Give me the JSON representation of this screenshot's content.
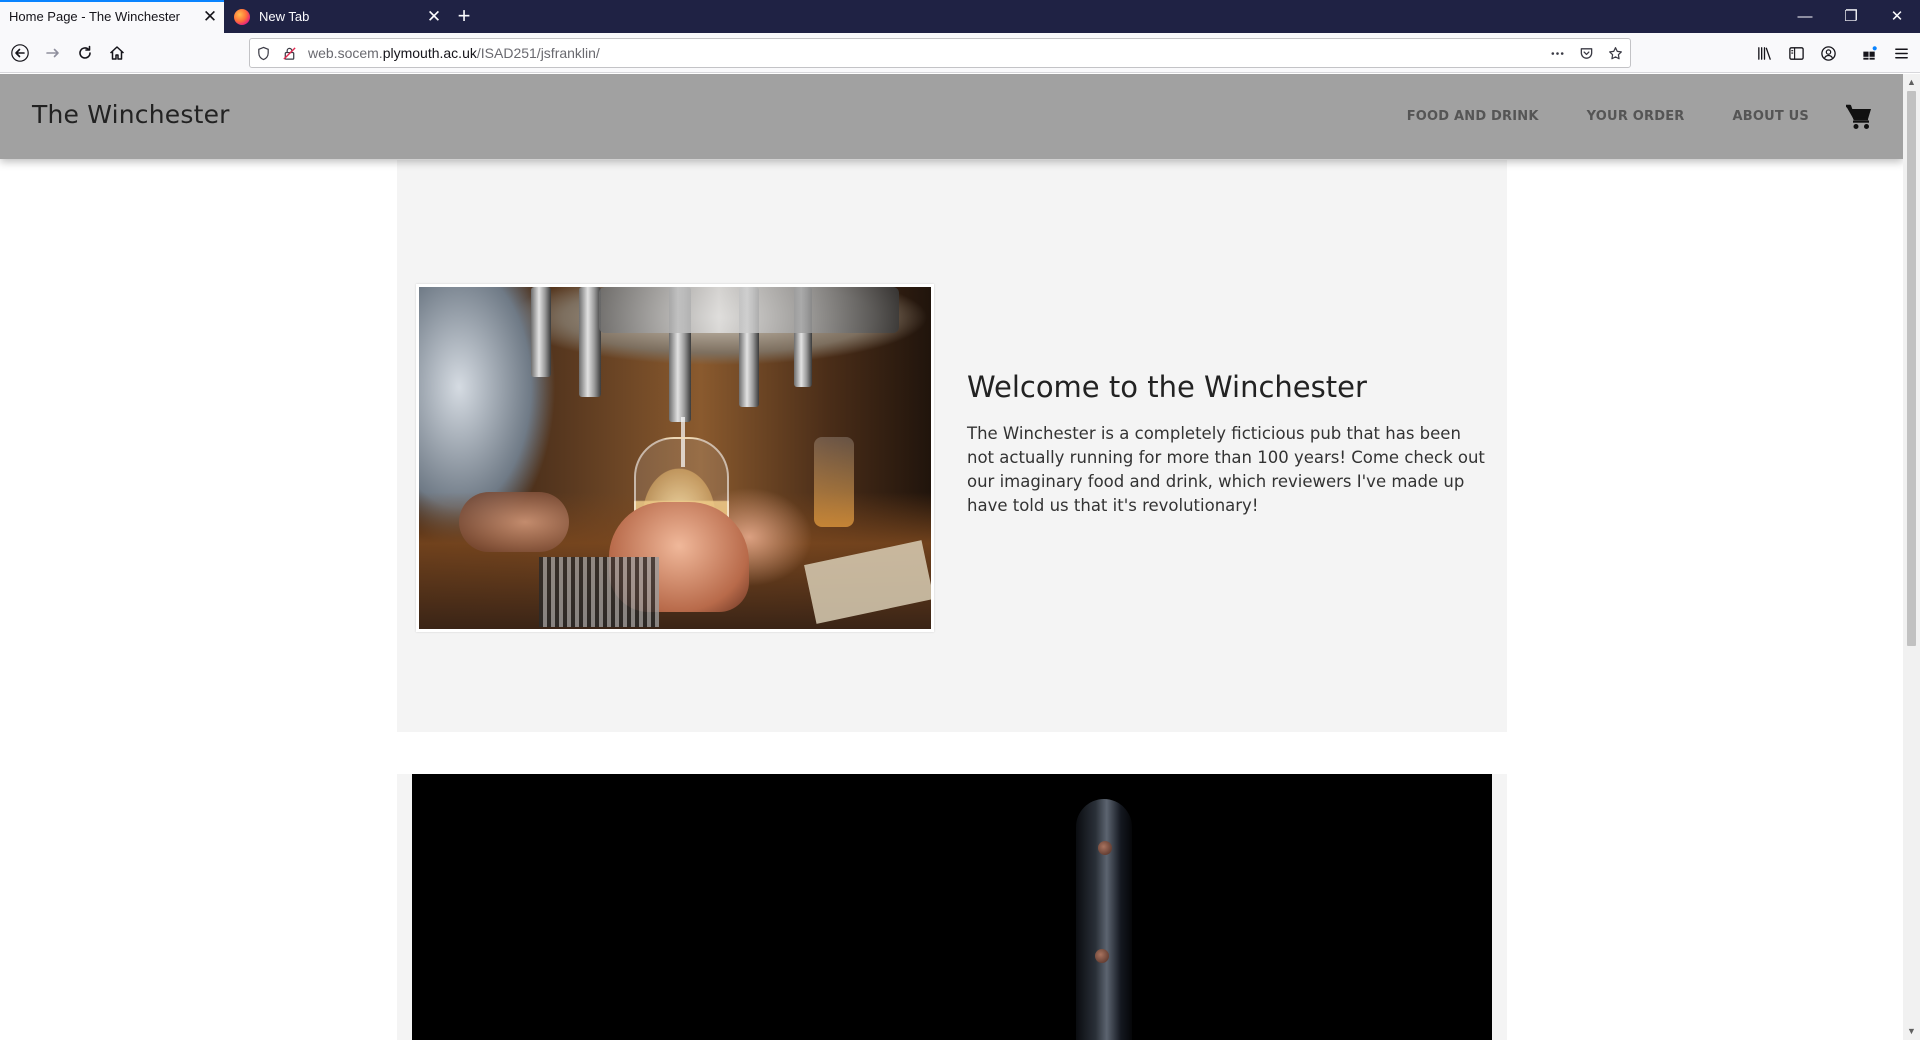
{
  "browser": {
    "tabs": [
      {
        "title": "Home Page - The Winchester",
        "active": true
      },
      {
        "title": "New Tab",
        "active": false
      }
    ],
    "url_prefix": "web.socem.",
    "url_domain": "plymouth.ac.uk",
    "url_path": "/ISAD251/jsfranklin/",
    "close_glyph": "✕",
    "newtab_glyph": "+",
    "window_controls": {
      "minimize": "—",
      "restore": "❐",
      "close": "✕"
    }
  },
  "site": {
    "brand": "The Winchester",
    "nav": [
      "FOOD AND DRINK",
      "YOUR ORDER",
      "ABOUT US"
    ],
    "cart_icon": "shopping-cart-icon"
  },
  "hero": {
    "title": "Welcome to the Winchester",
    "body": "The Winchester is a completely ficticious pub that has been not actually running for more than 100 years! Come check out our imaginary food and drink, which reviewers I've made up have told us that it's revolutionary!",
    "image": "beer-tap-photo"
  },
  "section2": {
    "image": "knife-photo"
  },
  "colors": {
    "titlebar": "#1f2244",
    "tab_accent": "#0a84ff",
    "header": "#a1a1a1",
    "hero_bg": "#f4f4f4"
  }
}
